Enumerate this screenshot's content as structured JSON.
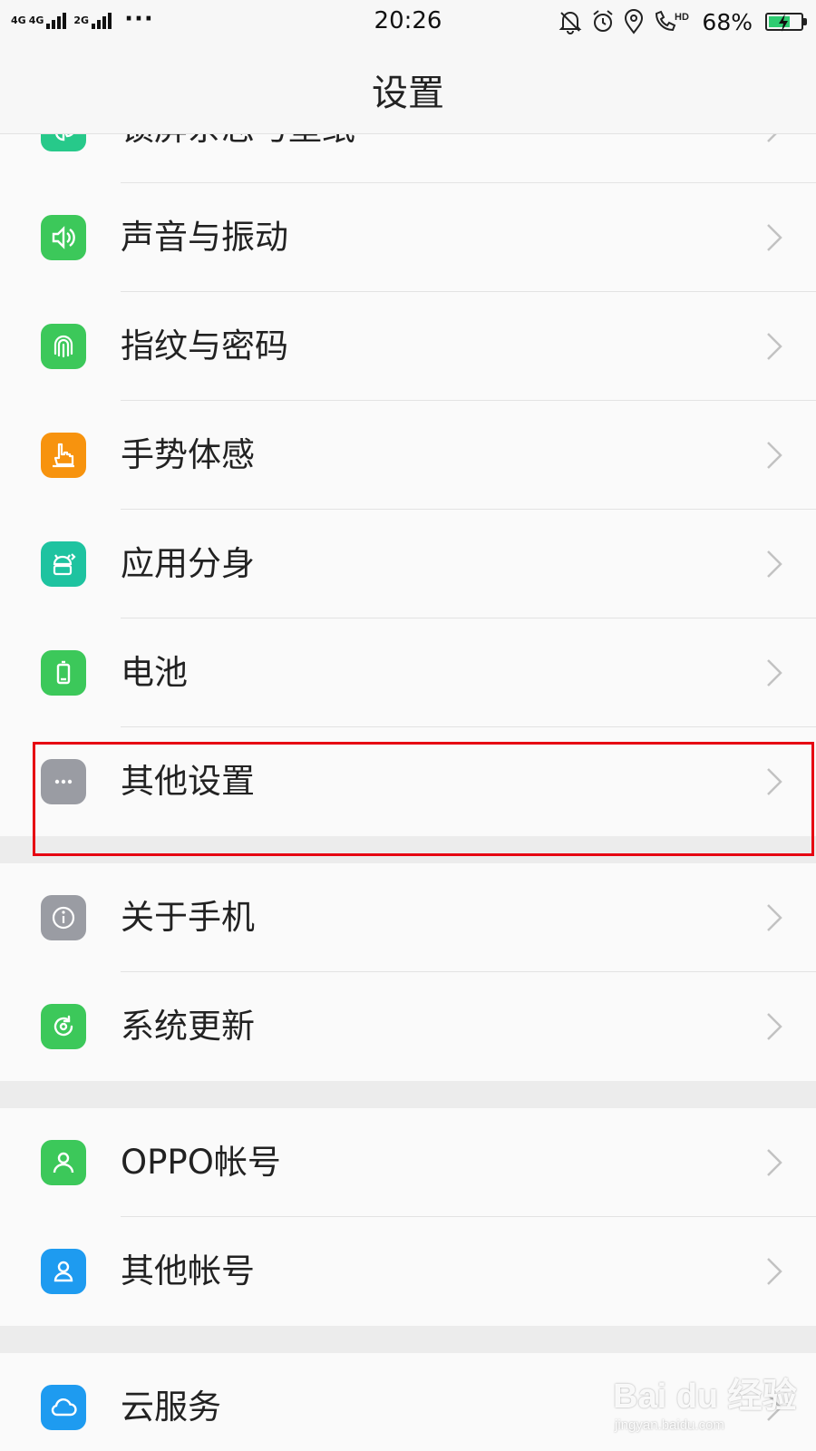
{
  "status_bar": {
    "network": [
      "4G",
      "4G",
      "2G"
    ],
    "dots": "···",
    "time": "20:26",
    "hd": "HD",
    "battery_percent": "68%",
    "battery_level": 0.68,
    "icons": [
      "bell-off-icon",
      "alarm-icon",
      "location-icon",
      "volte-call-icon",
      "battery-icon"
    ]
  },
  "header": {
    "title": "设置"
  },
  "groups": [
    {
      "items": [
        {
          "label": "锁屏杂志与壁纸",
          "icon": "pinwheel-icon",
          "color": "#27c98a"
        },
        {
          "label": "声音与振动",
          "icon": "speaker-icon",
          "color": "#3cc85a"
        },
        {
          "label": "指纹与密码",
          "icon": "fingerprint-icon",
          "color": "#3cc85a"
        },
        {
          "label": "手势体感",
          "icon": "hand-gesture-icon",
          "color": "#f7930e"
        },
        {
          "label": "应用分身",
          "icon": "android-clone-icon",
          "color": "#1ec3a0"
        },
        {
          "label": "电池",
          "icon": "battery-icon",
          "color": "#3cc85a"
        },
        {
          "label": "其他设置",
          "icon": "more-dots-icon",
          "color": "#9a9ca3"
        }
      ]
    },
    {
      "items": [
        {
          "label": "关于手机",
          "icon": "info-icon",
          "color": "#9a9ca3"
        },
        {
          "label": "系统更新",
          "icon": "update-icon",
          "color": "#3cc85a"
        }
      ]
    },
    {
      "items": [
        {
          "label": "OPPO帐号",
          "icon": "user-icon",
          "color": "#3cc85a"
        },
        {
          "label": "其他帐号",
          "icon": "account-icon",
          "color": "#1e9bf0"
        }
      ]
    },
    {
      "items": [
        {
          "label": "云服务",
          "icon": "cloud-icon",
          "color": "#1e9bf0"
        }
      ]
    }
  ],
  "highlight_color": "#e60012",
  "watermark": {
    "logo": "Bai du 经验",
    "url": "jingyan.baidu.com"
  }
}
